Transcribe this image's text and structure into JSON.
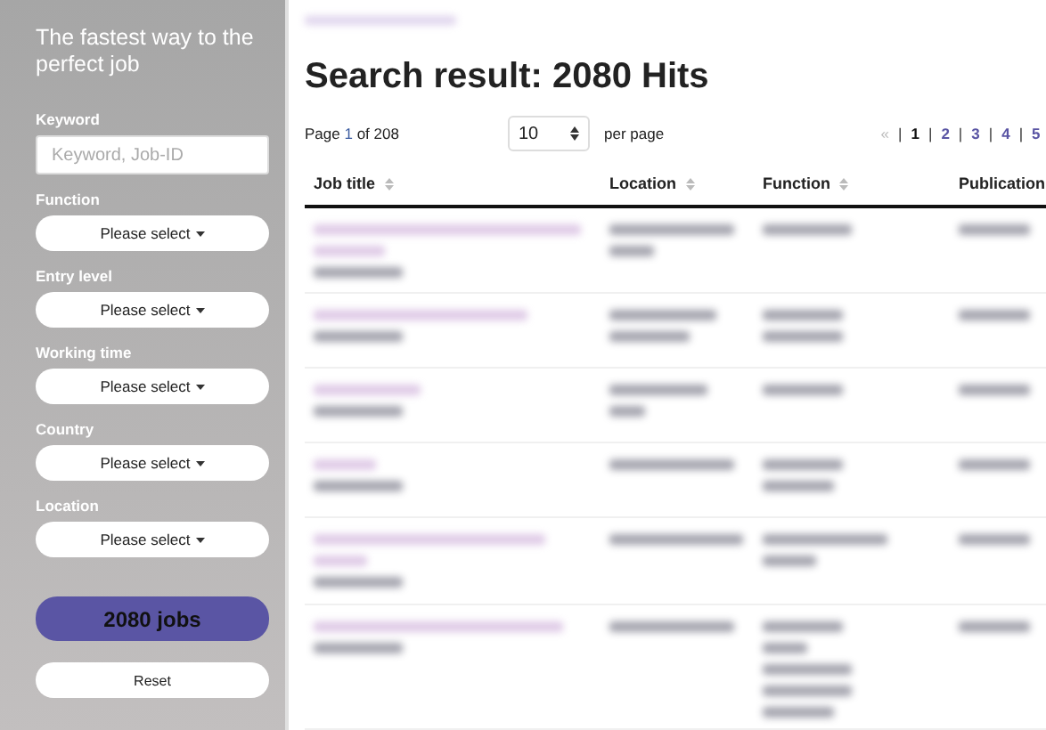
{
  "sidebar": {
    "tagline": "The fastest way to the perfect job",
    "keyword": {
      "label": "Keyword",
      "placeholder": "Keyword, Job-ID"
    },
    "filters": [
      {
        "label": "Function",
        "value": "Please select"
      },
      {
        "label": "Entry level",
        "value": "Please select"
      },
      {
        "label": "Working time",
        "value": "Please select"
      },
      {
        "label": "Country",
        "value": "Please select"
      },
      {
        "label": "Location",
        "value": "Please select"
      }
    ],
    "submit": "2080 jobs",
    "reset": "Reset"
  },
  "main": {
    "title": "Search result: 2080 Hits",
    "page_info": {
      "before": "Page ",
      "current": "1",
      "after": " of 208"
    },
    "per_page": {
      "value": "10",
      "label": "per page"
    },
    "pagination": {
      "prev": "«",
      "separator": "|",
      "pages": [
        {
          "label": "1",
          "selected": true
        },
        {
          "label": "2",
          "selected": false
        },
        {
          "label": "3",
          "selected": false
        },
        {
          "label": "4",
          "selected": false
        },
        {
          "label": "5",
          "selected": false
        }
      ]
    },
    "columns": [
      "Job title",
      "Location",
      "Function",
      "Publication"
    ]
  }
}
